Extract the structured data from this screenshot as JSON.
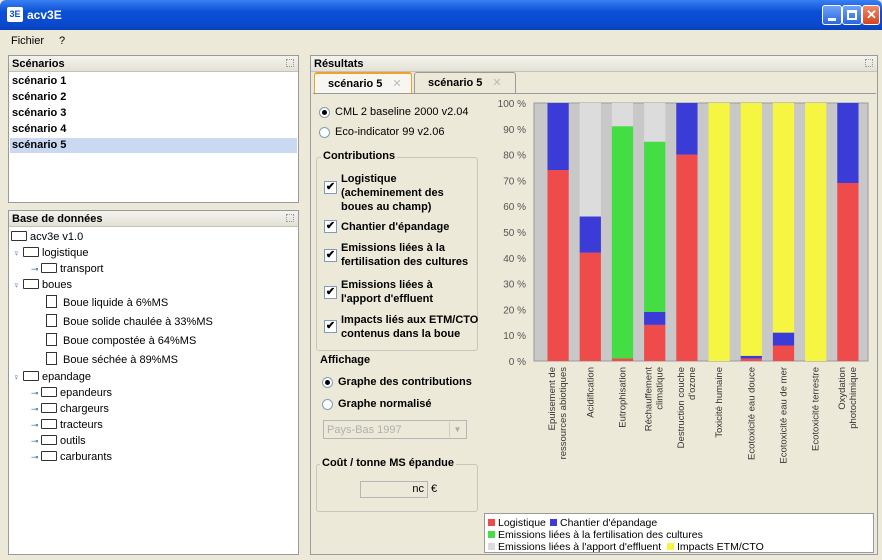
{
  "window": {
    "title": "acv3E",
    "icon_text": "3E"
  },
  "menu": {
    "items": [
      "Fichier",
      "?"
    ]
  },
  "scenarios": {
    "header": "Scénarios",
    "items": [
      "scénario 1",
      "scénario 2",
      "scénario 3",
      "scénario 4",
      "scénario 5"
    ],
    "selected_index": 4
  },
  "database": {
    "header": "Base de données",
    "root": "acv3e v1.0",
    "logistique": "logistique",
    "transport": "transport",
    "boues": "boues",
    "boue_items": [
      "Boue liquide à 6%MS",
      "Boue solide chaulée à 33%MS",
      "Boue compostée à 64%MS",
      "Boue séchée à 89%MS"
    ],
    "epandage": "epandage",
    "epandage_items": [
      "epandeurs",
      "chargeurs",
      "tracteurs",
      "outils",
      "carburants"
    ]
  },
  "results": {
    "header": "Résultats",
    "tabs": [
      "scénario 5",
      "scénario 5"
    ],
    "methods": [
      "CML 2 baseline 2000 v2.04",
      "Eco-indicator 99 v2.06"
    ],
    "contributions_title": "Contributions",
    "contributions": [
      {
        "lines": [
          "Logistique",
          "(acheminement des",
          "boues au champ)"
        ],
        "checked": true
      },
      {
        "lines": [
          "Chantier d'épandage"
        ],
        "checked": true
      },
      {
        "lines": [
          "Emissions liées à la",
          "fertilisation des cultures"
        ],
        "checked": true
      },
      {
        "lines": [
          "Emissions liées à",
          "l'apport d'effluent"
        ],
        "checked": true
      },
      {
        "lines": [
          "Impacts liés aux ETM/CTO",
          "contenus dans la boue"
        ],
        "checked": true
      }
    ],
    "affichage_title": "Affichage",
    "affichage": [
      "Graphe des contributions",
      "Graphe normalisé"
    ],
    "country": "Pays-Bas 1997",
    "cost_title": "Coût / tonne MS épandue",
    "cost_value": "nc",
    "cost_unit": "€"
  },
  "colors": {
    "logistique": "#f04b4b",
    "chantier": "#3b3bd8",
    "fertilisation": "#44dd44",
    "effluent": "#dcdcdc",
    "etm": "#f5f542"
  },
  "chart_data": {
    "type": "bar",
    "stacked": true,
    "normalized_percent": true,
    "categories": [
      "Epuisement de ressources abiotiques",
      "Acidification",
      "Eutrophisation",
      "Réchauffement climatique",
      "Destruction couche d'ozone",
      "Toxicité humaine",
      "Ecotoxicité eau douce",
      "Ecotoxicité eau de mer",
      "Ecotoxicité terrestre",
      "Oxydation photochimique"
    ],
    "series": [
      {
        "name": "Logistique",
        "color": "#f04b4b",
        "values": [
          74,
          42,
          1,
          14,
          80,
          0,
          1,
          6,
          0,
          69
        ]
      },
      {
        "name": "Chantier d'épandage",
        "color": "#3b3bd8",
        "values": [
          26,
          14,
          0,
          5,
          20,
          0,
          1,
          5,
          0,
          31
        ]
      },
      {
        "name": "Emissions liées à la fertilisation des cultures",
        "color": "#44dd44",
        "values": [
          0,
          0,
          90,
          66,
          0,
          0,
          0,
          0,
          0,
          0
        ]
      },
      {
        "name": "Emissions liées à l'apport d'effluent",
        "color": "#dcdcdc",
        "values": [
          0,
          44,
          9,
          15,
          0,
          0,
          0,
          0,
          0,
          0
        ]
      },
      {
        "name": "Impacts ETM/CTO",
        "color": "#f5f542",
        "values": [
          0,
          0,
          0,
          0,
          0,
          100,
          98,
          89,
          100,
          0
        ]
      }
    ],
    "y_ticks": [
      "0 %",
      "10 %",
      "20 %",
      "30 %",
      "40 %",
      "50 %",
      "60 %",
      "70 %",
      "80 %",
      "90 %",
      "100 %"
    ],
    "ylim": [
      0,
      100
    ],
    "legend_position": "bottom"
  }
}
